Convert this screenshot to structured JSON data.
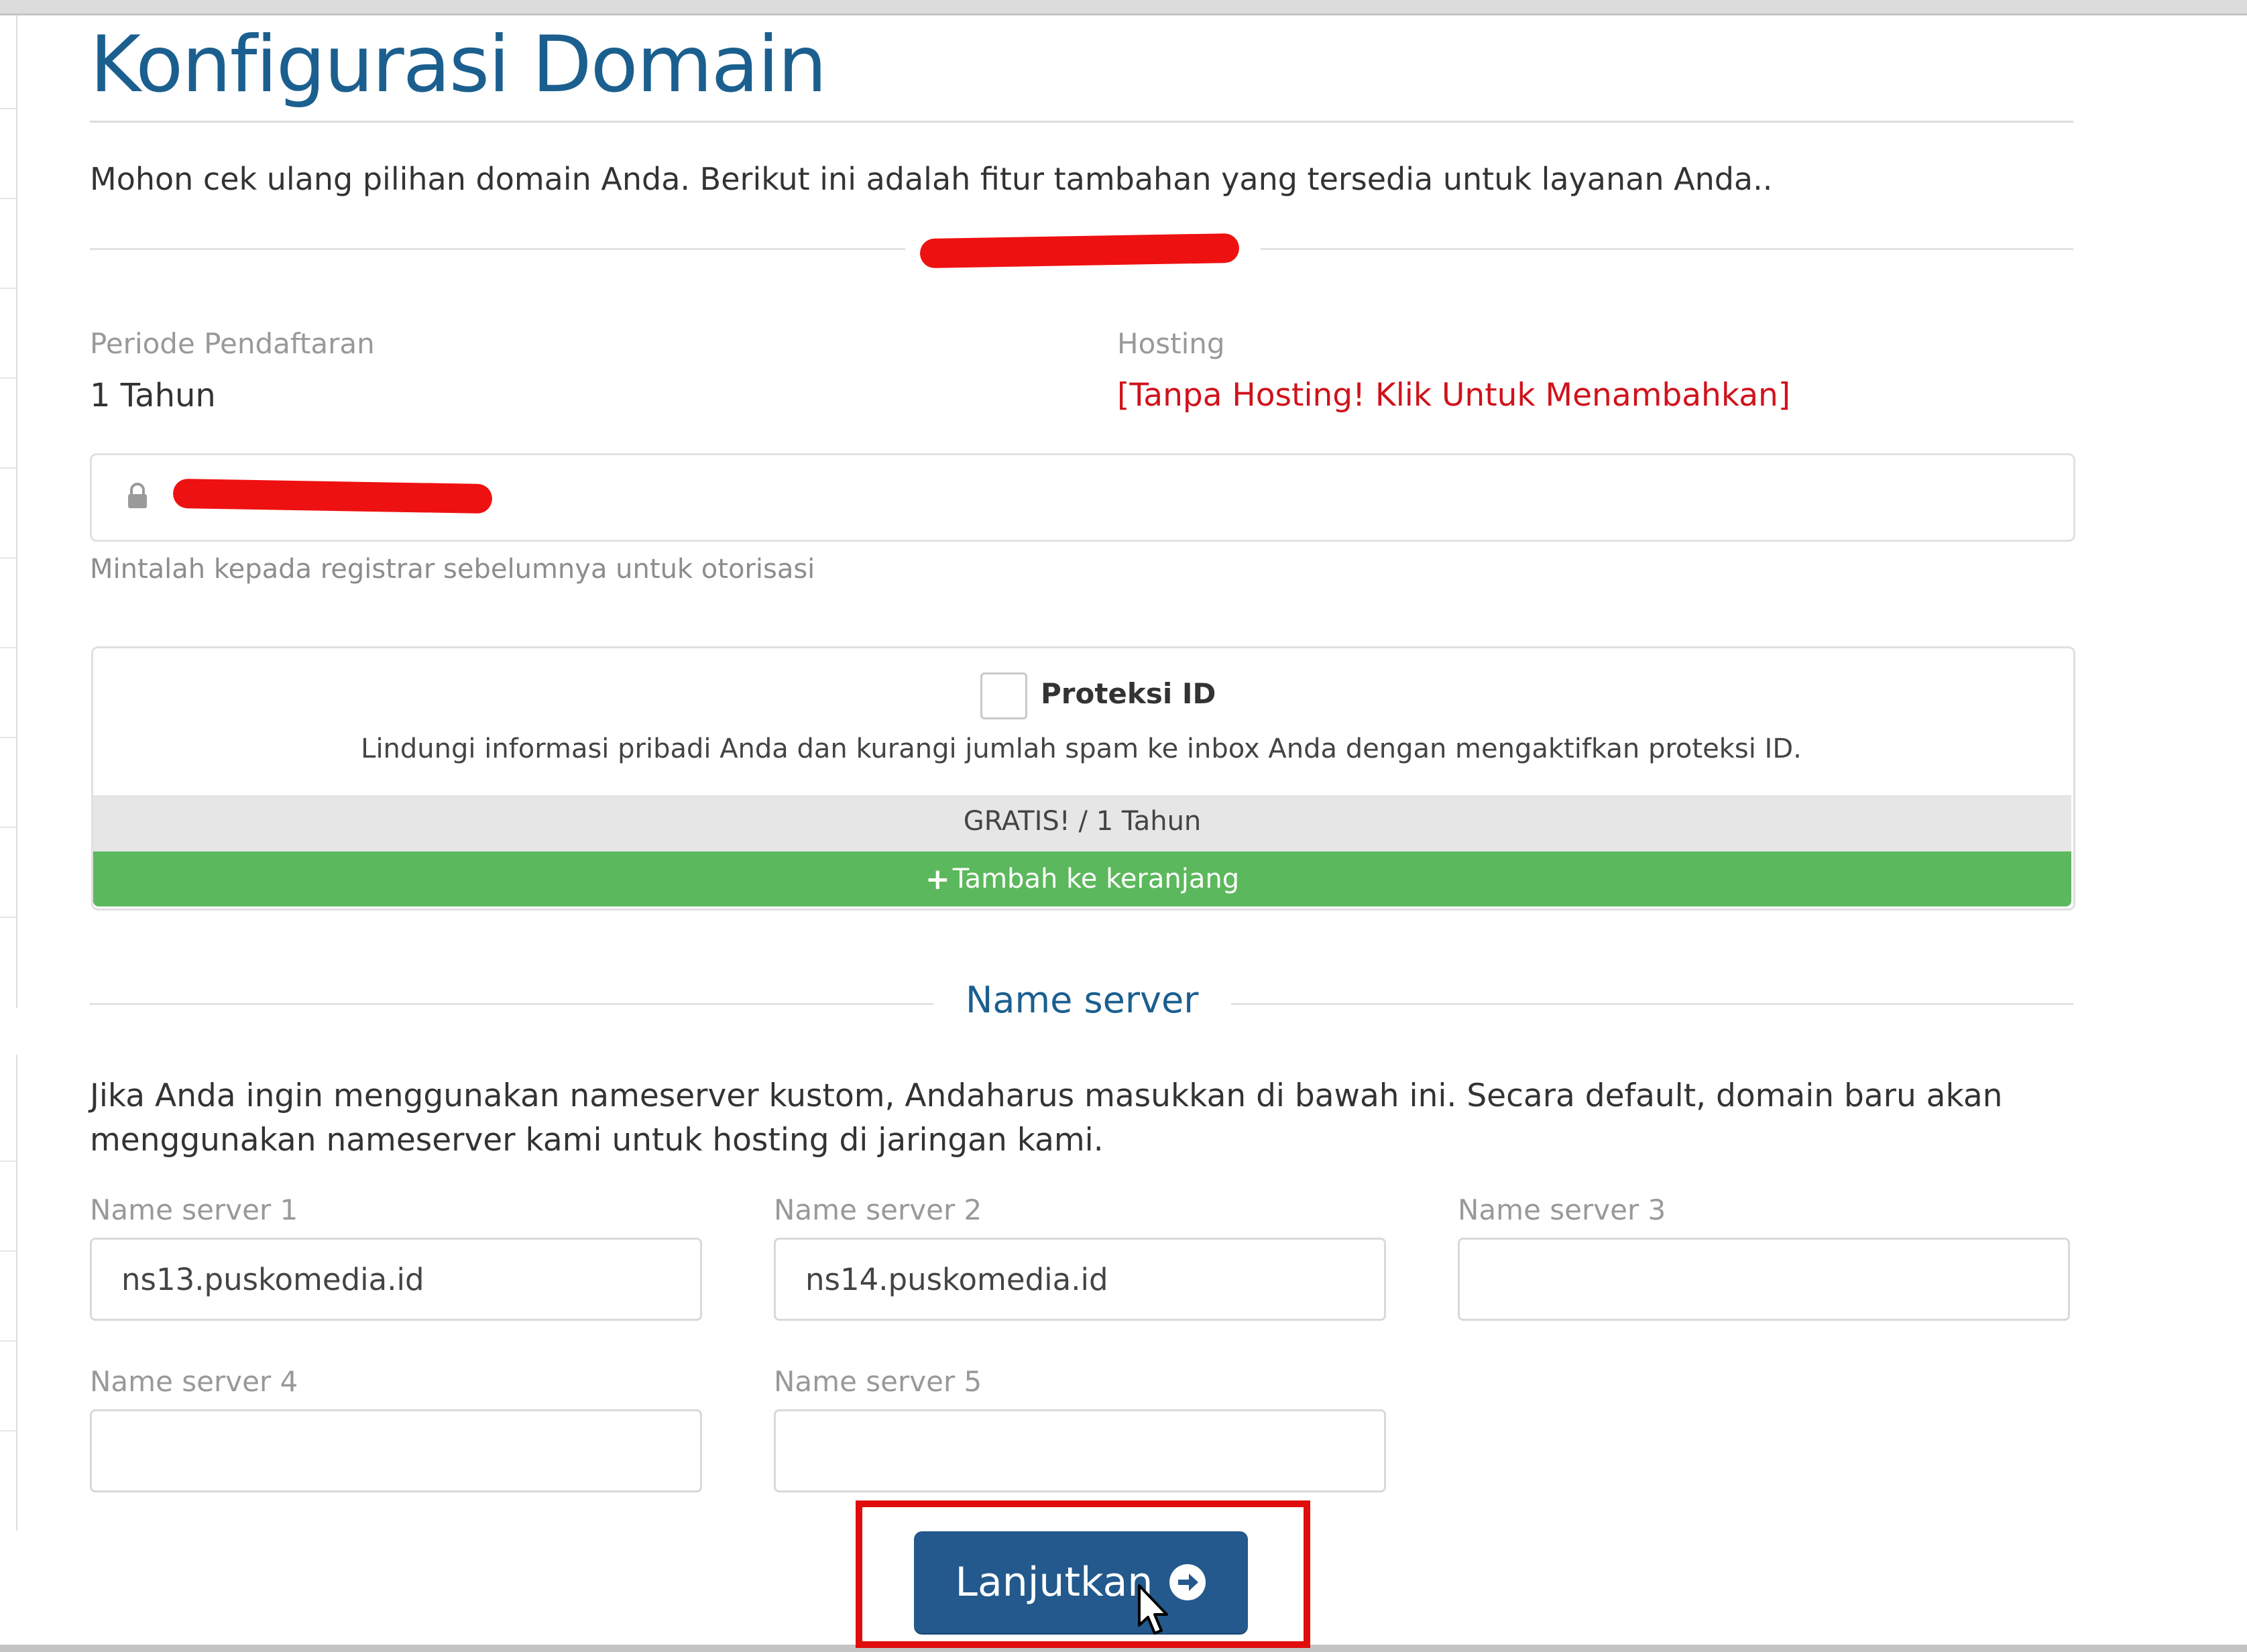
{
  "page": {
    "title": "Konfigurasi Domain",
    "intro": "Mohon cek ulang pilihan domain Anda. Berikut ini adalah fitur tambahan yang tersedia untuk layanan Anda.."
  },
  "registration": {
    "period_label": "Periode Pendaftaran",
    "period_value": "1 Tahun",
    "hosting_label": "Hosting",
    "hosting_link": "[Tanpa Hosting! Klik Untuk Menambahkan]"
  },
  "epp": {
    "helper": "Mintalah kepada registrar sebelumnya untuk otorisasi",
    "icon": "lock-icon"
  },
  "addon": {
    "name": "Proteksi ID",
    "description": "Lindungi informasi pribadi Anda dan kurangi jumlah spam ke inbox Anda dengan mengaktifkan proteksi ID.",
    "price": "GRATIS! / 1 Tahun",
    "add_button": "Tambah ke keranjang",
    "checked": false
  },
  "nameservers": {
    "heading": "Name server",
    "intro": "Jika Anda ingin menggunakan nameserver kustom, Andaharus masukkan di bawah ini. Secara default, domain baru akan menggunakan nameserver kami untuk hosting di jaringan kami.",
    "fields": [
      {
        "label": "Name server 1",
        "value": "ns13.puskomedia.id"
      },
      {
        "label": "Name server 2",
        "value": "ns14.puskomedia.id"
      },
      {
        "label": "Name server 3",
        "value": ""
      },
      {
        "label": "Name server 4",
        "value": ""
      },
      {
        "label": "Name server 5",
        "value": ""
      }
    ]
  },
  "actions": {
    "continue_label": "Lanjutkan",
    "continue_icon": "arrow-circle-right-icon"
  },
  "colors": {
    "heading_blue": "#1b5f8f",
    "link_red": "#d0121b",
    "success_green": "#5cb85c",
    "button_blue": "#23598c",
    "highlight_red": "#e00d0d"
  }
}
